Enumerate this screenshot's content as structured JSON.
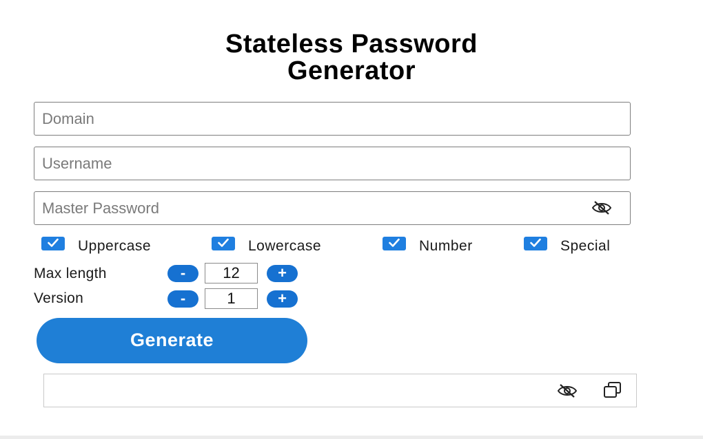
{
  "title": {
    "line1": "Stateless Password",
    "line2": "Generator"
  },
  "fields": {
    "domain": {
      "placeholder": "Domain",
      "value": ""
    },
    "username": {
      "placeholder": "Username",
      "value": ""
    },
    "master_password": {
      "placeholder": "Master Password",
      "value": "",
      "visibility_icon": "eye-slash-icon"
    }
  },
  "options": [
    {
      "label": "Uppercase",
      "checked": true
    },
    {
      "label": "Lowercase",
      "checked": true
    },
    {
      "label": "Number",
      "checked": true
    },
    {
      "label": "Special",
      "checked": true
    }
  ],
  "max_length": {
    "label": "Max length",
    "decrement": "-",
    "value": "12",
    "increment": "+"
  },
  "version": {
    "label": "Version",
    "decrement": "-",
    "value": "1",
    "increment": "+"
  },
  "generate": {
    "label": "Generate"
  },
  "result": {
    "value": "",
    "visibility_icon": "eye-slash-icon",
    "copy_icon": "copy-icon"
  },
  "colors": {
    "accent": "#1f7fd6",
    "stepper": "#1671d1",
    "checkbox": "#1f7fe0"
  }
}
